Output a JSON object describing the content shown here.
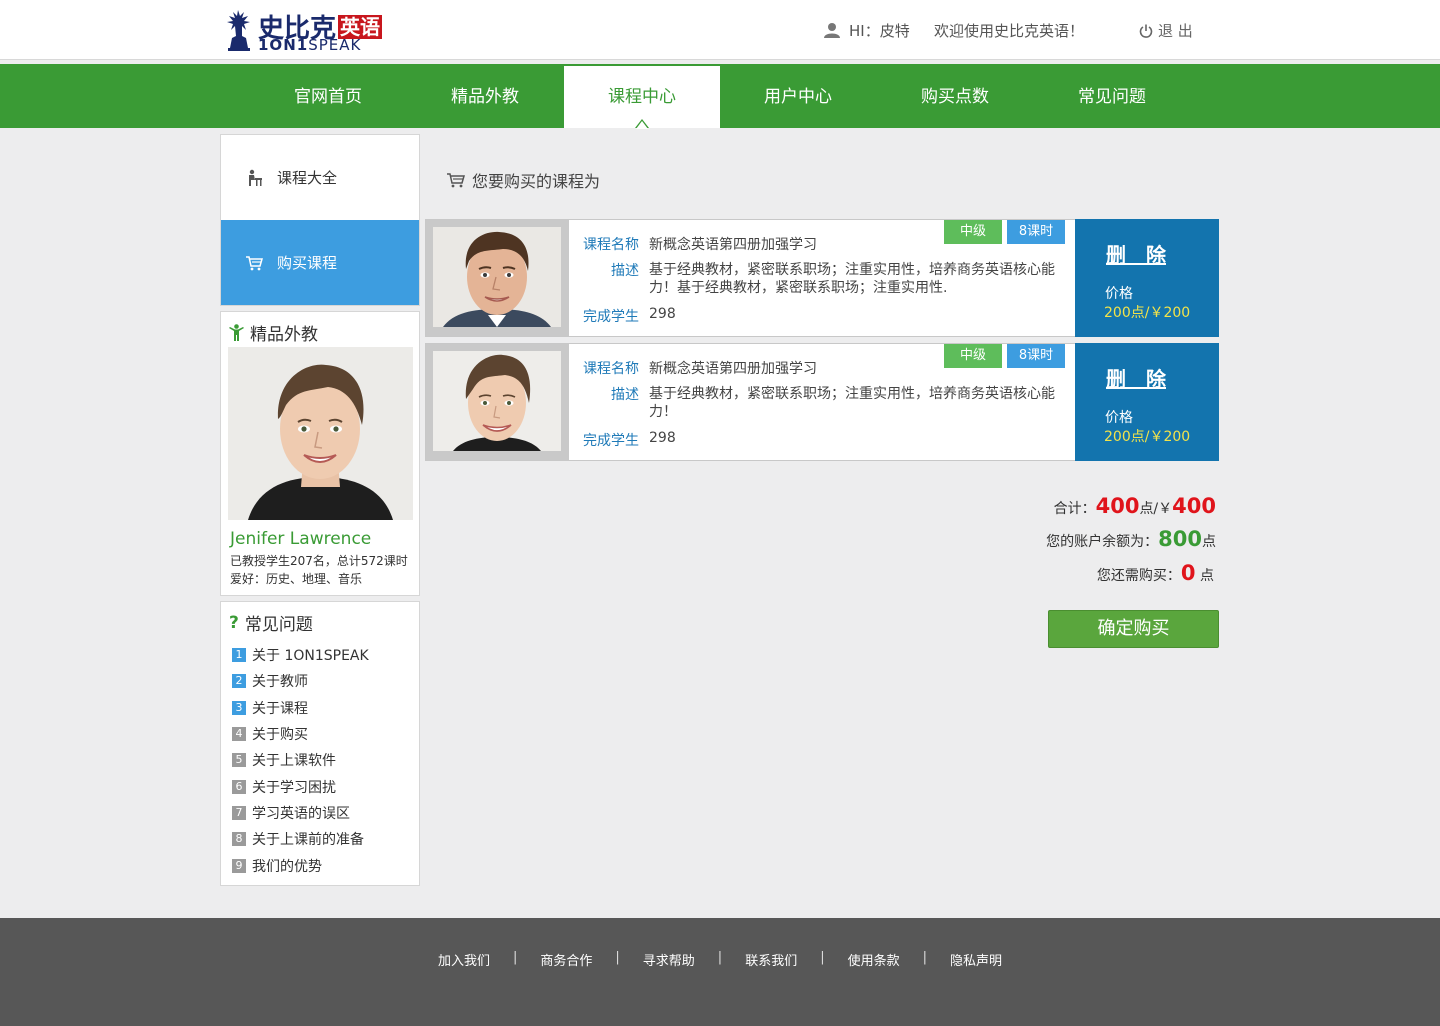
{
  "header": {
    "logo_cn": "史比克",
    "logo_cn_red": "英语",
    "logo_en_bold": "1ON1",
    "logo_en": "SPEAK",
    "greeting": "HI：皮特",
    "welcome": "欢迎使用史比克英语！",
    "logout": "退 出"
  },
  "nav": {
    "items": [
      {
        "label": "官网首页"
      },
      {
        "label": "精品外教"
      },
      {
        "label": "课程中心"
      },
      {
        "label": "用户中心"
      },
      {
        "label": "购买点数"
      },
      {
        "label": "常见问题"
      }
    ],
    "active_index": 2
  },
  "sidebar": {
    "menu": [
      {
        "label": "课程大全",
        "icon": "student-desk-icon"
      },
      {
        "label": "购买课程",
        "icon": "cart-icon"
      }
    ],
    "teacher": {
      "title": "精品外教",
      "name": "Jenifer Lawrence",
      "stats": "已教授学生207名，总计572课时",
      "hobby": "爱好：历史、地理、音乐"
    },
    "faq": {
      "title": "常见问题",
      "items": [
        {
          "num": "1",
          "label": "关于 1ON1SPEAK"
        },
        {
          "num": "2",
          "label": "关于教师"
        },
        {
          "num": "3",
          "label": "关于课程"
        },
        {
          "num": "4",
          "label": "关于购买"
        },
        {
          "num": "5",
          "label": "关于上课软件"
        },
        {
          "num": "6",
          "label": "关于学习困扰"
        },
        {
          "num": "7",
          "label": "学习英语的误区"
        },
        {
          "num": "8",
          "label": "关于上课前的准备"
        },
        {
          "num": "9",
          "label": "我们的优势"
        }
      ]
    }
  },
  "main": {
    "title": "您要购买的课程为",
    "courses": [
      {
        "name_label": "课程名称",
        "name": "新概念英语第四册加强学习",
        "desc_label": "描述",
        "desc": "基于经典教材，紧密联系职场；注重实用性，培养商务英语核心能力！基于经典教材，紧密联系职场；注重实用性.",
        "students_label": "完成学生",
        "students": "298",
        "level": "中级",
        "hours": "8课时",
        "delete": "删　除",
        "price_label": "价格",
        "price": "200点/￥200"
      },
      {
        "name_label": "课程名称",
        "name": "新概念英语第四册加强学习",
        "desc_label": "描述",
        "desc": "基于经典教材，紧密联系职场；注重实用性，培养商务英语核心能力！",
        "students_label": "完成学生",
        "students": "298",
        "level": "中级",
        "hours": "8课时",
        "delete": "删　除",
        "price_label": "价格",
        "price": "200点/￥200"
      }
    ],
    "totals": {
      "total_label": "合计：",
      "total_points": "400",
      "total_points_unit": "点/￥",
      "total_money": "400",
      "balance_label": "您的账户余额为：",
      "balance": "800",
      "balance_unit": "点",
      "need_label": "您还需购买：",
      "need": "0",
      "need_unit": " 点"
    },
    "confirm": "确定购买"
  },
  "footer": {
    "links": [
      "加入我们",
      "商务合作",
      "寻求帮助",
      "联系我们",
      "使用条款",
      "隐私声明"
    ],
    "separator": "|"
  },
  "colors": {
    "nav_green": "#3a9b35",
    "sidebar_blue": "#3d9de0",
    "price_panel": "#1374ae",
    "accent_red": "#e0141b",
    "footer": "#575757"
  }
}
